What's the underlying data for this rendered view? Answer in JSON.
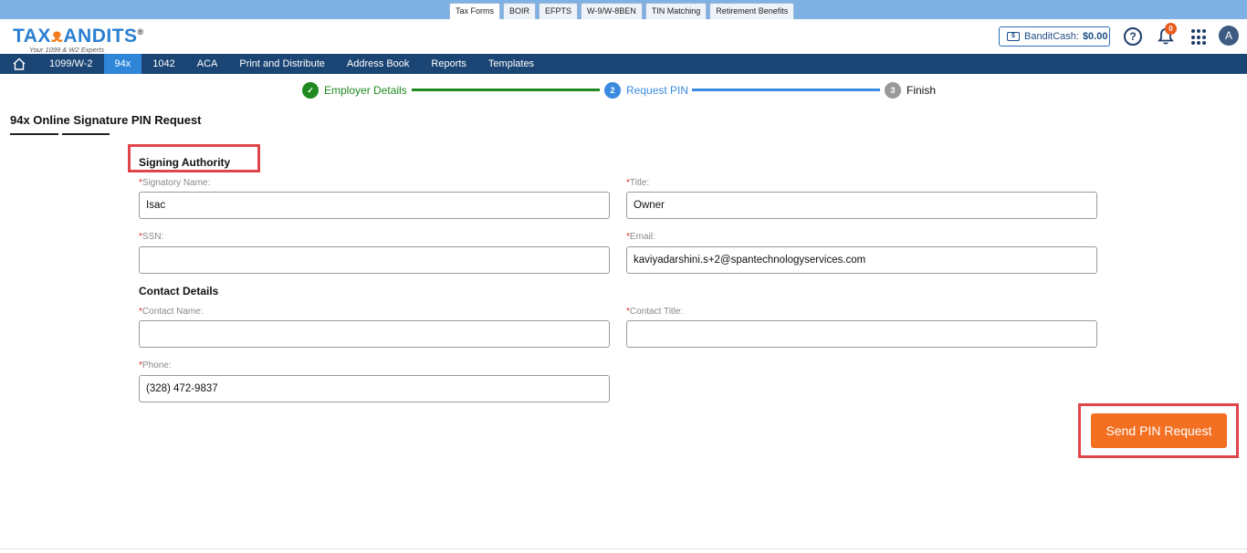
{
  "product_tabs": [
    "Tax Forms",
    "BOIR",
    "EFPTS",
    "W-9/W-8BEN",
    "TIN Matching",
    "Retirement Benefits"
  ],
  "logo": {
    "text_left": "TAX",
    "text_right": "ANDITS",
    "registered": "®",
    "tagline": "Your 1099 & W2 Experts"
  },
  "header": {
    "bandit_cash_label": "BanditCash:",
    "bandit_cash_amount": "$0.00",
    "notification_count": "0",
    "avatar_initial": "A",
    "help_glyph": "?"
  },
  "nav": [
    "1099/W-2",
    "94x",
    "1042",
    "ACA",
    "Print and Distribute",
    "Address Book",
    "Reports",
    "Templates"
  ],
  "stepper": [
    {
      "number": "✓",
      "label": "Employer Details"
    },
    {
      "number": "2",
      "label": "Request PIN"
    },
    {
      "number": "3",
      "label": "Finish"
    }
  ],
  "page_title": "94x Online Signature PIN Request",
  "signing_authority": {
    "title": "Signing Authority",
    "signatory_name_label": "Signatory Name:",
    "signatory_name_value": "Isac",
    "title_label": "Title:",
    "title_value": "Owner",
    "ssn_label": "SSN:",
    "ssn_value": "",
    "email_label": "Email:",
    "email_value": "kaviyadarshini.s+2@spantechnologyservices.com"
  },
  "contact_details": {
    "title": "Contact Details",
    "contact_name_label": "Contact Name:",
    "contact_name_value": "",
    "contact_title_label": "Contact Title:",
    "contact_title_value": "",
    "phone_label": "Phone:",
    "phone_value": "(328) 472-9837"
  },
  "required_marker": "*",
  "send_button": "Send PIN Request"
}
